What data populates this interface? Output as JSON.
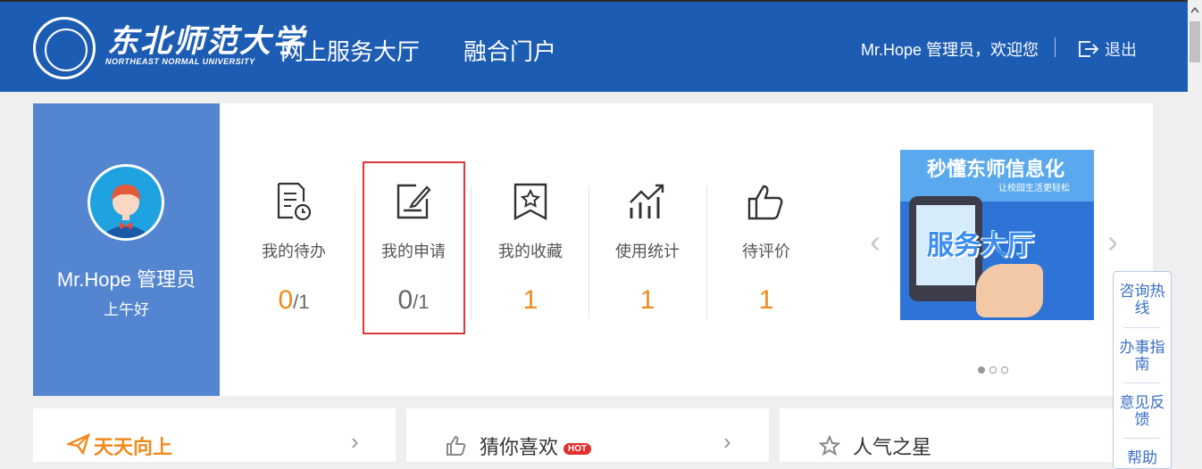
{
  "header": {
    "logo_cn": "东北师范大学",
    "logo_en": "NORTHEAST NORMAL UNIVERSITY",
    "nav": [
      "网上服务大厅",
      "融合门户"
    ],
    "greeting": "Mr.Hope 管理员，欢迎您",
    "logout": "退出"
  },
  "profile": {
    "name": "Mr.Hope 管理员",
    "greeting": "上午好"
  },
  "stats": [
    {
      "label": "我的待办",
      "value": "0",
      "total": "/1",
      "icon": "todo-clock-icon"
    },
    {
      "label": "我的申请",
      "value": "0",
      "total": "/1",
      "icon": "edit-document-icon"
    },
    {
      "label": "我的收藏",
      "value": "1",
      "total": "",
      "icon": "bookmark-star-icon"
    },
    {
      "label": "使用统计",
      "value": "1",
      "total": "",
      "icon": "chart-growth-icon"
    },
    {
      "label": "待评价",
      "value": "1",
      "total": "",
      "icon": "thumbs-up-icon"
    }
  ],
  "banner": {
    "title": "秒懂东师信息化",
    "subtitle": "让校园生活更轻松",
    "main": "服务大厅",
    "prev": "‹",
    "next": "›"
  },
  "cards": [
    {
      "title": "天天向上",
      "icon": "paper-plane-icon"
    },
    {
      "title": "猜你喜欢",
      "badge": "HOT",
      "icon": "thumbs-up-icon"
    },
    {
      "title": "人气之星",
      "icon": "star-icon"
    }
  ],
  "side_panel": [
    "咨询热线",
    "办事指南",
    "意见反馈",
    "帮助"
  ],
  "colors": {
    "header_bg": "#1d5cb3",
    "profile_bg": "#5485d0",
    "accent": "#f08a1c",
    "highlight": "#e03636"
  }
}
